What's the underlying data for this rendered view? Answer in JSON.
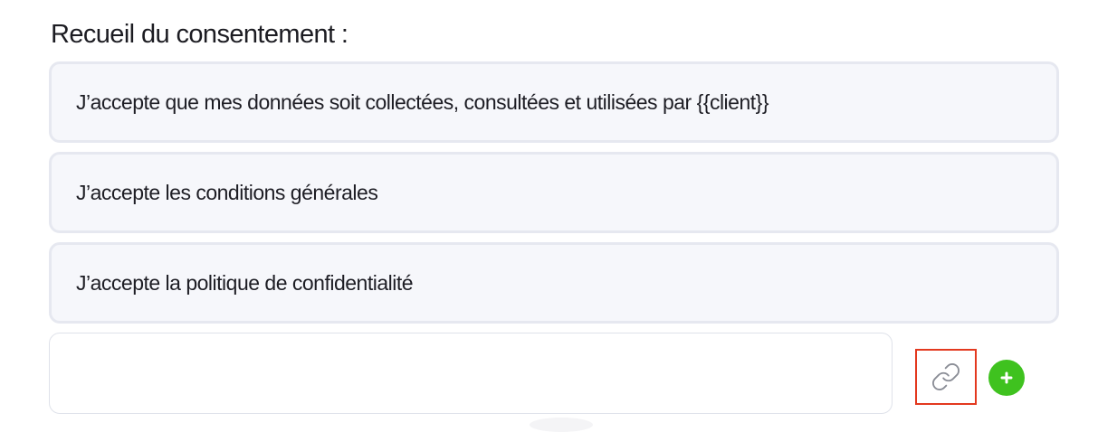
{
  "consent_section": {
    "title": "Recueil du consentement :",
    "items": [
      {
        "label": "J’accepte que mes données soit collectées, consultées et utilisées par {{client}}"
      },
      {
        "label": "J’accepte les conditions générales"
      },
      {
        "label": "J’accepte la politique de confidentialité"
      }
    ],
    "new_item": {
      "value": "",
      "placeholder": ""
    },
    "actions": {
      "link_icon": "link-icon",
      "add_icon": "plus-icon",
      "add_color": "#3fc21f",
      "highlight_color": "#e3391f"
    }
  }
}
